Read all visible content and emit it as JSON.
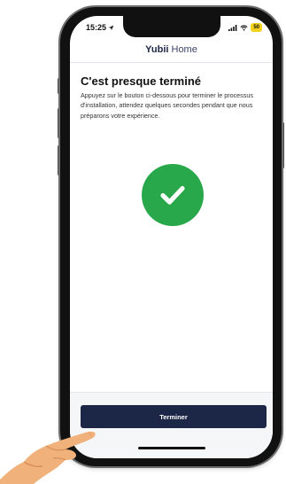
{
  "status_bar": {
    "time": "15:25",
    "battery": "50",
    "icons": [
      "location-arrow-icon",
      "signal-icon",
      "wifi-icon",
      "battery-icon"
    ]
  },
  "header": {
    "brand_bold": "Yubii",
    "brand_light": "Home"
  },
  "content": {
    "title": "C'est presque terminé",
    "description": "Appuyez sur le bouton ci-dessous pour terminer le processus d'installation, attendez quelques secondes pendant que nous préparons votre expérience.",
    "status_icon": "checkmark-icon"
  },
  "footer": {
    "button_label": "Terminer"
  },
  "colors": {
    "brand_navy": "#1c2647",
    "success_green": "#28a84a",
    "battery_yellow": "#f2d21b"
  }
}
